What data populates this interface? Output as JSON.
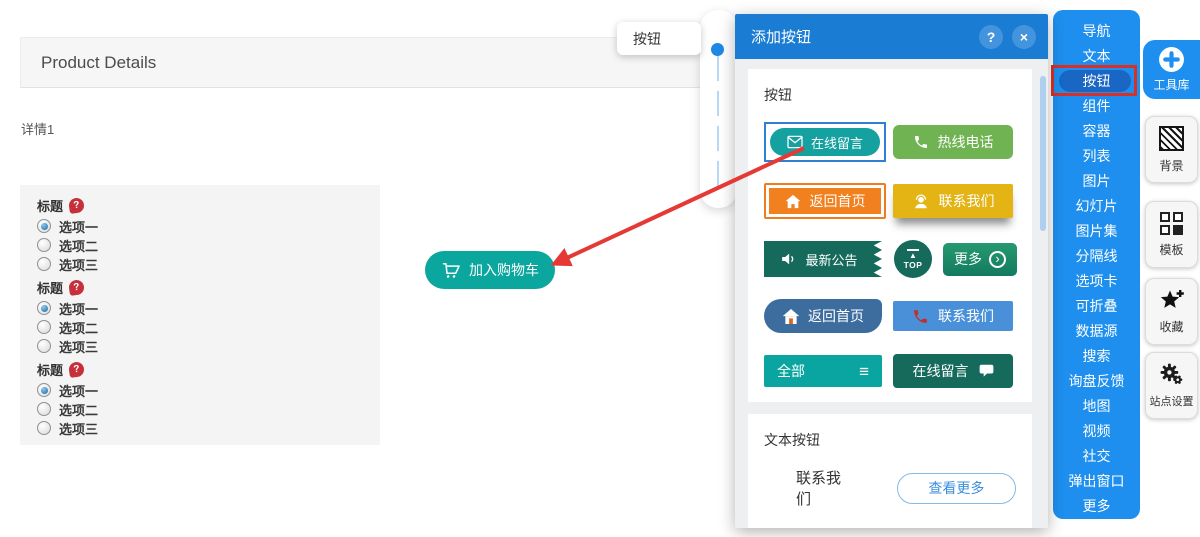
{
  "canvas": {
    "header_title": "Product Details",
    "detail_label": "详情1",
    "help_glyph": "?",
    "add_to_cart_label": "加入购物车",
    "option_groups": [
      {
        "title": "标题",
        "options": [
          {
            "label": "选项一",
            "selected": true
          },
          {
            "label": "选项二",
            "selected": false
          },
          {
            "label": "选项三",
            "selected": false
          }
        ]
      },
      {
        "title": "标题",
        "options": [
          {
            "label": "选项一",
            "selected": true
          },
          {
            "label": "选项二",
            "selected": false
          },
          {
            "label": "选项三",
            "selected": false
          }
        ]
      },
      {
        "title": "标题",
        "options": [
          {
            "label": "选项一",
            "selected": true
          },
          {
            "label": "选项二",
            "selected": false
          },
          {
            "label": "选项三",
            "selected": false
          }
        ]
      }
    ]
  },
  "tooltip": {
    "label": "按钮"
  },
  "dialog": {
    "title": "添加按钮",
    "help_label": "?",
    "close_label": "×",
    "section_buttons_label": "按钮",
    "section_text_label": "文本按钮",
    "samples": {
      "online_message": "在线留言",
      "hotline": "热线电话",
      "back_home": "返回首页",
      "contact_us": "联系我们",
      "latest_news": "最新公告",
      "top": "TOP",
      "more": "更多",
      "back_home_alt": "返回首页",
      "contact_us_alt": "联系我们",
      "all": "全部",
      "online_message_alt": "在线留言"
    },
    "text_buttons": {
      "contact_us": "联系我们",
      "view_more": "查看更多"
    }
  },
  "sidebar": {
    "items": [
      {
        "label": "导航"
      },
      {
        "label": "文本"
      },
      {
        "label": "按钮",
        "active": true
      },
      {
        "label": "组件"
      },
      {
        "label": "容器"
      },
      {
        "label": "列表"
      },
      {
        "label": "图片"
      },
      {
        "label": "幻灯片"
      },
      {
        "label": "图片集"
      },
      {
        "label": "分隔线"
      },
      {
        "label": "选项卡"
      },
      {
        "label": "可折叠"
      },
      {
        "label": "数据源"
      },
      {
        "label": "搜索"
      },
      {
        "label": "询盘反馈"
      },
      {
        "label": "地图"
      },
      {
        "label": "视频"
      },
      {
        "label": "社交"
      },
      {
        "label": "弹出窗口"
      },
      {
        "label": "更多"
      }
    ]
  },
  "tools": [
    {
      "label": "工具库"
    },
    {
      "label": "背景"
    },
    {
      "label": "模板"
    },
    {
      "label": "收藏"
    },
    {
      "label": "站点设置"
    }
  ],
  "glyphs": {
    "hamburger": "≡",
    "chevron_right": "›",
    "arrow_up": "▲"
  },
  "colors": {
    "sidebar_blue": "#1e8fee",
    "dialog_header_blue": "#1b7cd4",
    "active_pill_blue": "#1a66c4",
    "highlight_red": "#d93025",
    "arrow_red": "#e53935",
    "teal": "#14a19f",
    "cart_teal": "#0ba79e",
    "green": "#6fb352",
    "orange": "#f1801f",
    "yellow": "#e4b314",
    "dark_teal": "#156a5c",
    "steel_blue": "#3d6d9e",
    "light_blue": "#4a90d9",
    "all_teal": "#0aa5a0",
    "link_blue": "#3b8fdd"
  }
}
